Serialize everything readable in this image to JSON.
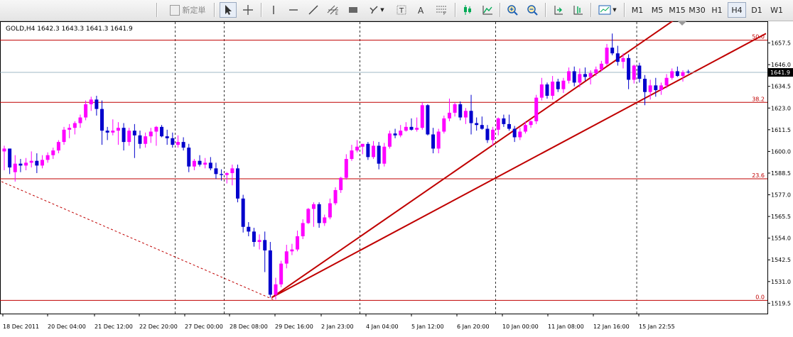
{
  "toolbar": {
    "new_order_label": "新定単",
    "timeframes": [
      "M1",
      "M5",
      "M15",
      "M30",
      "H1",
      "H4",
      "D1",
      "W1"
    ],
    "active_timeframe": "H4"
  },
  "chart_data": {
    "type": "candlestick",
    "title": "GOLD,H4  1642.3 1643.3 1641.3 1641.9",
    "symbol": "GOLD",
    "timeframe": "H4",
    "ohlc_label": "1642.3 1643.3 1641.3 1641.9",
    "current_price": "1641.9",
    "ylim": [
      1514,
      1669
    ],
    "y_ticks": [
      "1657.5",
      "1646.0",
      "1634.5",
      "1623.0",
      "1611.5",
      "1600.0",
      "1588.5",
      "1577.0",
      "1565.5",
      "1554.0",
      "1542.5",
      "1531.0",
      "1519.5"
    ],
    "x_labels": [
      "18 Dec 2011",
      "20 Dec 04:00",
      "21 Dec 12:00",
      "22 Dec 20:00",
      "27 Dec 00:00",
      "28 Dec 08:00",
      "29 Dec 16:00",
      "2 Jan 23:00",
      "4 Jan 04:00",
      "5 Jan 12:00",
      "6 Jan 20:00",
      "10 Jan 00:00",
      "11 Jan 08:00",
      "12 Jan 16:00",
      "15 Jan 22:55"
    ],
    "fibonacci_levels": [
      {
        "label": "50.0",
        "price": 1659.0
      },
      {
        "label": "38.2",
        "price": 1626.0
      },
      {
        "label": "23.6",
        "price": 1585.5
      },
      {
        "label": "0.0",
        "price": 1521.0
      }
    ],
    "bull_color": "#ff00ff",
    "bear_color": "#0000cc",
    "fib_color": "#c00000",
    "trendline_color": "#c00000",
    "candles": [
      [
        1600.0,
        1603.0,
        1590.0,
        1601.5
      ],
      [
        1601.5,
        1601.5,
        1588.0,
        1591.5
      ],
      [
        1589.0,
        1598.0,
        1584.0,
        1593.5
      ],
      [
        1593.5,
        1596.0,
        1589.0,
        1592.5
      ],
      [
        1592.5,
        1596.5,
        1590.0,
        1594.0
      ],
      [
        1594.0,
        1600.0,
        1591.5,
        1595.0
      ],
      [
        1595.0,
        1599.0,
        1588.5,
        1592.5
      ],
      [
        1592.5,
        1598.0,
        1591.0,
        1595.5
      ],
      [
        1595.5,
        1599.5,
        1594.0,
        1598.0
      ],
      [
        1598.0,
        1602.0,
        1596.0,
        1600.5
      ],
      [
        1600.5,
        1606.0,
        1599.0,
        1605.0
      ],
      [
        1605.0,
        1613.0,
        1603.5,
        1611.5
      ],
      [
        1611.5,
        1614.5,
        1607.0,
        1612.5
      ],
      [
        1612.5,
        1616.0,
        1609.0,
        1615.0
      ],
      [
        1615.0,
        1619.5,
        1612.5,
        1618.0
      ],
      [
        1618.0,
        1627.0,
        1616.5,
        1625.0
      ],
      [
        1625.0,
        1629.0,
        1621.5,
        1627.5
      ],
      [
        1627.5,
        1629.5,
        1619.0,
        1622.5
      ],
      [
        1622.5,
        1627.0,
        1603.5,
        1611.0
      ],
      [
        1611.0,
        1613.0,
        1606.0,
        1610.0
      ],
      [
        1610.0,
        1617.0,
        1608.5,
        1611.0
      ],
      [
        1611.0,
        1615.5,
        1603.5,
        1612.5
      ],
      [
        1612.5,
        1615.0,
        1600.5,
        1605.0
      ],
      [
        1605.0,
        1612.5,
        1603.0,
        1611.0
      ],
      [
        1611.0,
        1614.5,
        1596.5,
        1608.5
      ],
      [
        1608.5,
        1611.0,
        1601.5,
        1604.0
      ],
      [
        1604.0,
        1610.0,
        1602.0,
        1608.0
      ],
      [
        1608.0,
        1612.5,
        1604.5,
        1610.5
      ],
      [
        1610.5,
        1613.5,
        1603.0,
        1613.0
      ],
      [
        1613.0,
        1614.0,
        1607.5,
        1608.0
      ],
      [
        1608.0,
        1611.5,
        1603.5,
        1607.0
      ],
      [
        1607.0,
        1610.0,
        1602.0,
        1603.5
      ],
      [
        1603.5,
        1608.5,
        1602.0,
        1605.0
      ],
      [
        1605.0,
        1607.5,
        1600.5,
        1602.0
      ],
      [
        1602.0,
        1604.0,
        1589.0,
        1592.0
      ],
      [
        1592.0,
        1596.0,
        1590.0,
        1595.0
      ],
      [
        1595.0,
        1598.0,
        1592.0,
        1593.0
      ],
      [
        1593.0,
        1596.5,
        1591.0,
        1594.0
      ],
      [
        1594.0,
        1597.0,
        1590.0,
        1591.0
      ],
      [
        1591.0,
        1594.0,
        1585.5,
        1588.0
      ],
      [
        1588.0,
        1590.5,
        1584.5,
        1587.5
      ],
      [
        1587.5,
        1589.0,
        1583.0,
        1588.5
      ],
      [
        1588.5,
        1593.0,
        1582.0,
        1591.0
      ],
      [
        1591.0,
        1593.0,
        1573.0,
        1575.0
      ],
      [
        1575.0,
        1577.0,
        1557.0,
        1560.0
      ],
      [
        1560.0,
        1562.5,
        1555.0,
        1557.5
      ],
      [
        1557.5,
        1559.5,
        1549.5,
        1552.0
      ],
      [
        1552.0,
        1556.0,
        1548.0,
        1553.0
      ],
      [
        1553.0,
        1557.5,
        1536.0,
        1547.5
      ],
      [
        1547.5,
        1552.0,
        1522.5,
        1524.0
      ],
      [
        1524.0,
        1533.0,
        1521.5,
        1529.5
      ],
      [
        1529.5,
        1542.0,
        1528.0,
        1540.5
      ],
      [
        1540.5,
        1550.5,
        1538.0,
        1547.0
      ],
      [
        1547.0,
        1551.0,
        1545.0,
        1548.0
      ],
      [
        1548.0,
        1558.0,
        1547.0,
        1555.0
      ],
      [
        1555.0,
        1564.0,
        1553.5,
        1562.0
      ],
      [
        1562.0,
        1570.0,
        1561.5,
        1569.5
      ],
      [
        1569.5,
        1573.0,
        1560.0,
        1572.0
      ],
      [
        1572.0,
        1573.0,
        1559.5,
        1562.0
      ],
      [
        1562.0,
        1566.5,
        1560.5,
        1565.0
      ],
      [
        1565.0,
        1575.0,
        1564.0,
        1572.5
      ],
      [
        1572.5,
        1581.0,
        1571.5,
        1579.5
      ],
      [
        1579.5,
        1586.5,
        1578.0,
        1586.0
      ],
      [
        1586.0,
        1598.5,
        1585.0,
        1596.0
      ],
      [
        1596.0,
        1603.5,
        1595.0,
        1600.5
      ],
      [
        1600.5,
        1606.0,
        1599.5,
        1602.5
      ],
      [
        1602.5,
        1604.0,
        1598.5,
        1604.0
      ],
      [
        1604.0,
        1605.0,
        1595.5,
        1597.0
      ],
      [
        1597.0,
        1605.5,
        1596.0,
        1603.0
      ],
      [
        1603.0,
        1605.0,
        1590.5,
        1593.5
      ],
      [
        1593.5,
        1604.5,
        1592.0,
        1602.5
      ],
      [
        1602.5,
        1611.0,
        1601.5,
        1609.5
      ],
      [
        1609.5,
        1612.0,
        1607.0,
        1608.5
      ],
      [
        1608.5,
        1614.0,
        1607.5,
        1611.0
      ],
      [
        1611.0,
        1615.5,
        1610.5,
        1613.0
      ],
      [
        1613.0,
        1617.5,
        1611.0,
        1611.5
      ],
      [
        1611.5,
        1618.0,
        1610.5,
        1612.5
      ],
      [
        1612.5,
        1626.0,
        1611.5,
        1624.5
      ],
      [
        1624.5,
        1625.0,
        1608.5,
        1609.0
      ],
      [
        1609.0,
        1612.5,
        1599.0,
        1601.5
      ],
      [
        1601.5,
        1612.0,
        1599.0,
        1610.5
      ],
      [
        1610.5,
        1619.0,
        1609.5,
        1617.5
      ],
      [
        1617.5,
        1628.0,
        1616.0,
        1620.5
      ],
      [
        1620.5,
        1626.0,
        1618.5,
        1625.0
      ],
      [
        1625.0,
        1626.5,
        1616.5,
        1618.0
      ],
      [
        1618.0,
        1623.0,
        1614.5,
        1621.5
      ],
      [
        1621.5,
        1630.0,
        1609.0,
        1615.0
      ],
      [
        1615.0,
        1618.0,
        1611.0,
        1614.0
      ],
      [
        1614.0,
        1618.5,
        1611.5,
        1612.0
      ],
      [
        1612.0,
        1614.0,
        1604.5,
        1606.0
      ],
      [
        1606.0,
        1613.0,
        1603.0,
        1611.5
      ],
      [
        1611.5,
        1618.0,
        1608.5,
        1617.5
      ],
      [
        1617.5,
        1619.5,
        1613.0,
        1614.5
      ],
      [
        1614.5,
        1619.5,
        1611.0,
        1612.0
      ],
      [
        1612.0,
        1613.5,
        1605.0,
        1607.5
      ],
      [
        1607.5,
        1612.5,
        1606.0,
        1610.5
      ],
      [
        1610.5,
        1616.0,
        1609.5,
        1614.0
      ],
      [
        1614.0,
        1616.5,
        1612.5,
        1616.0
      ],
      [
        1616.0,
        1630.0,
        1614.5,
        1628.5
      ],
      [
        1628.5,
        1639.0,
        1627.0,
        1635.5
      ],
      [
        1635.5,
        1636.5,
        1628.0,
        1629.5
      ],
      [
        1629.5,
        1640.0,
        1627.5,
        1637.0
      ],
      [
        1637.0,
        1638.5,
        1631.5,
        1633.0
      ],
      [
        1633.0,
        1639.0,
        1631.0,
        1637.5
      ],
      [
        1637.5,
        1644.5,
        1636.0,
        1642.5
      ],
      [
        1642.5,
        1645.0,
        1634.5,
        1636.5
      ],
      [
        1636.5,
        1644.0,
        1634.0,
        1641.0
      ],
      [
        1641.0,
        1644.5,
        1637.5,
        1639.5
      ],
      [
        1639.5,
        1643.0,
        1635.5,
        1641.5
      ],
      [
        1641.5,
        1645.0,
        1640.0,
        1643.5
      ],
      [
        1643.5,
        1648.0,
        1642.5,
        1646.5
      ],
      [
        1646.5,
        1657.0,
        1645.5,
        1655.0
      ],
      [
        1655.0,
        1662.5,
        1651.0,
        1652.0
      ],
      [
        1652.0,
        1656.0,
        1645.5,
        1647.5
      ],
      [
        1647.5,
        1652.0,
        1644.0,
        1649.5
      ],
      [
        1649.5,
        1651.5,
        1633.0,
        1638.0
      ],
      [
        1638.0,
        1646.0,
        1636.0,
        1645.5
      ],
      [
        1645.5,
        1647.0,
        1636.5,
        1638.5
      ],
      [
        1638.5,
        1640.5,
        1624.5,
        1631.5
      ],
      [
        1631.5,
        1638.0,
        1627.5,
        1635.0
      ],
      [
        1635.0,
        1639.0,
        1629.0,
        1632.5
      ],
      [
        1632.5,
        1636.5,
        1630.0,
        1635.0
      ],
      [
        1635.0,
        1641.0,
        1633.5,
        1639.0
      ],
      [
        1639.0,
        1644.0,
        1638.0,
        1642.5
      ],
      [
        1642.5,
        1645.0,
        1639.5,
        1640.0
      ],
      [
        1640.0,
        1643.0,
        1637.0,
        1642.0
      ],
      [
        1642.3,
        1643.3,
        1641.3,
        1641.9
      ]
    ]
  }
}
